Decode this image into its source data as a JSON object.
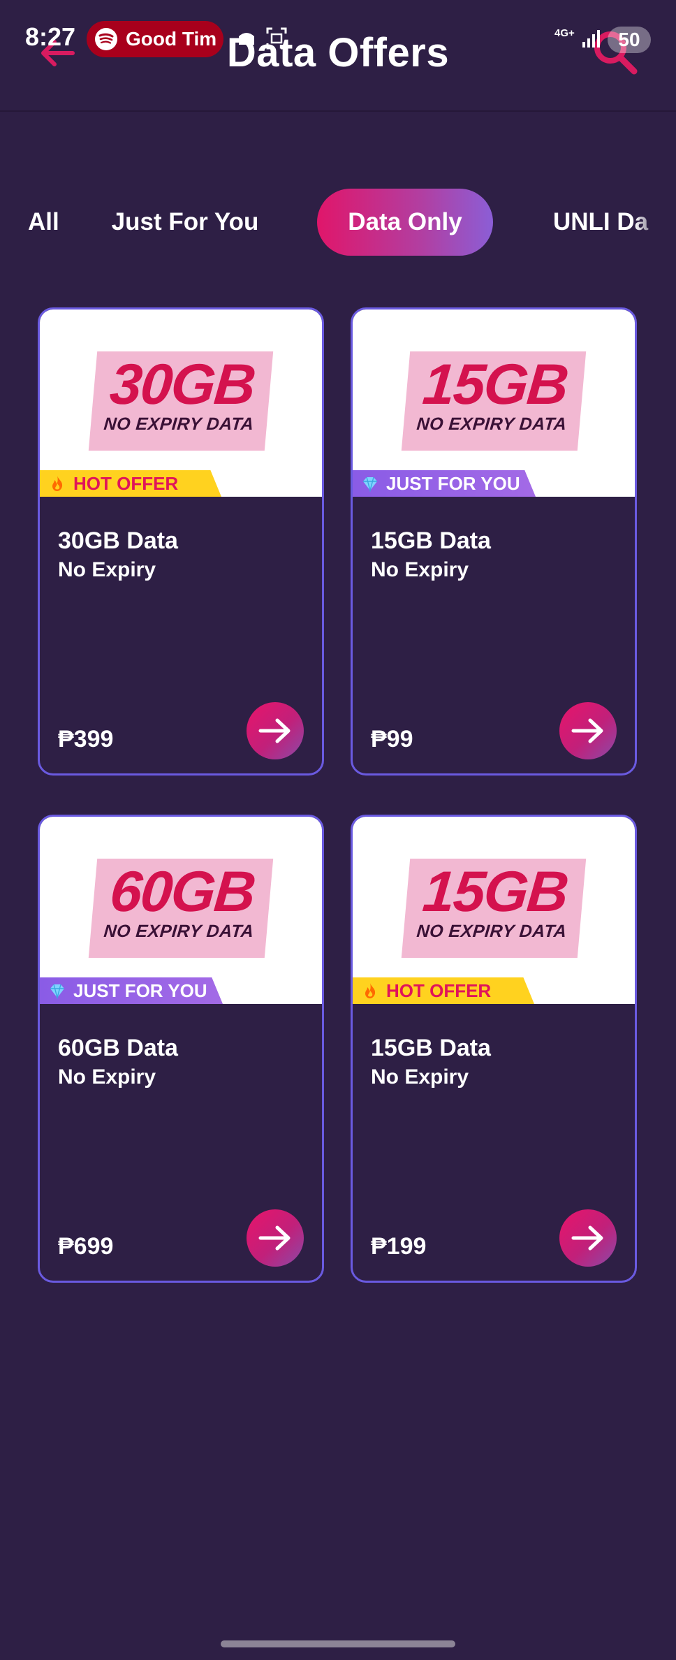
{
  "status_bar": {
    "time": "8:27",
    "media_text": "Good Tim",
    "network": "4G+",
    "battery": "50"
  },
  "header": {
    "title": "Data Offers"
  },
  "tabs": [
    {
      "label": "All",
      "selected": false
    },
    {
      "label": "Just For You",
      "selected": false
    },
    {
      "label": "Data Only",
      "selected": true
    },
    {
      "label": "UNLI Da",
      "selected": false
    }
  ],
  "offers": [
    {
      "promo_size": "30GB",
      "promo_sub": "NO EXPIRY DATA",
      "badge": "HOT OFFER",
      "badge_type": "hot",
      "badge_icon": "fire-icon",
      "title": "30GB Data",
      "subtitle": "No Expiry",
      "price": "₱399"
    },
    {
      "promo_size": "15GB",
      "promo_sub": "NO EXPIRY DATA",
      "badge": "JUST FOR YOU",
      "badge_type": "jfy",
      "badge_icon": "diamond-icon",
      "title": "15GB Data",
      "subtitle": "No Expiry",
      "price": "₱99"
    },
    {
      "promo_size": "60GB",
      "promo_sub": "NO EXPIRY DATA",
      "badge": "JUST FOR YOU",
      "badge_type": "jfy",
      "badge_icon": "diamond-icon",
      "title": "60GB Data",
      "subtitle": "No Expiry",
      "price": "₱699"
    },
    {
      "promo_size": "15GB",
      "promo_sub": "NO EXPIRY DATA",
      "badge": "HOT OFFER",
      "badge_type": "hot",
      "badge_icon": "fire-icon",
      "title": "15GB Data",
      "subtitle": "No Expiry",
      "price": "₱199"
    }
  ],
  "colors": {
    "background": "#2e1f45",
    "accent_pink": "#e0166a",
    "accent_purple": "#8b5ed6",
    "card_border": "#6a5ae0",
    "hot_badge": "#ffd21f",
    "promo_pink": "#f2b8d2"
  }
}
